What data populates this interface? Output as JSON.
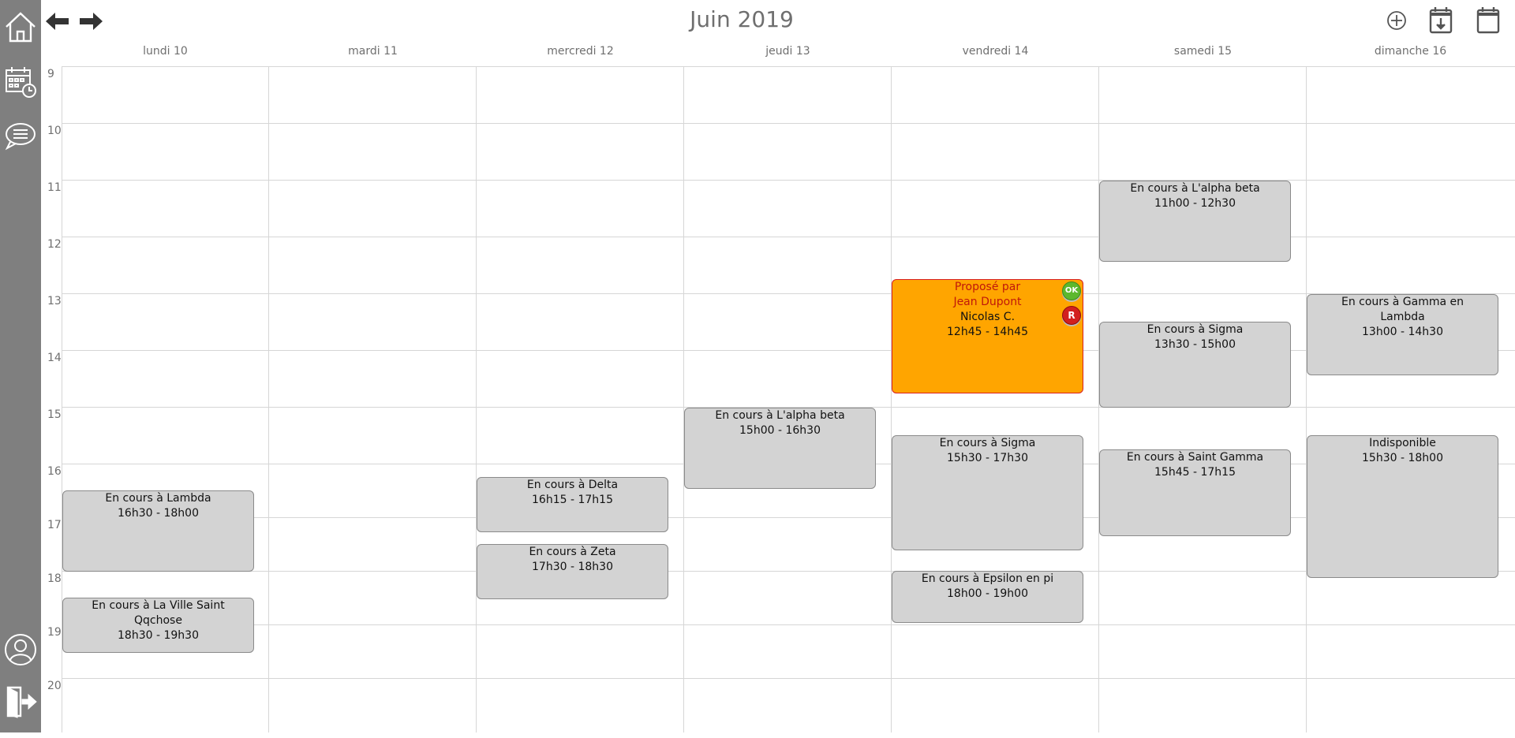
{
  "calendar": {
    "title": "Juin 2019"
  },
  "sidebar": {
    "items": [
      {
        "name": "home-icon"
      },
      {
        "name": "calendar-clock-icon"
      },
      {
        "name": "chat-icon"
      },
      {
        "name": "user-icon"
      },
      {
        "name": "logout-icon"
      }
    ]
  },
  "toolbar": {
    "icons": [
      "arrow-left-icon",
      "arrow-right-icon",
      "add-icon",
      "calendar-download-icon",
      "calendar-icon"
    ]
  },
  "days": [
    "lundi 10",
    "mardi 11",
    "mercredi 12",
    "jeudi 13",
    "vendredi 14",
    "samedi 15",
    "dimanche 16"
  ],
  "hours": [
    "9",
    "10",
    "11",
    "12",
    "13",
    "14",
    "15",
    "16",
    "17",
    "18",
    "19",
    "20"
  ],
  "events": [
    {
      "day": 0,
      "lines": [
        "En cours à Lambda",
        "16h30 - 18h00"
      ]
    },
    {
      "day": 0,
      "lines": [
        "En cours à La Ville Saint",
        "Qqchose",
        "18h30 - 19h30"
      ]
    },
    {
      "day": 2,
      "lines": [
        "En cours à Delta",
        "16h15 - 17h15"
      ]
    },
    {
      "day": 2,
      "lines": [
        "En cours à Zeta",
        "17h30 - 18h30"
      ]
    },
    {
      "day": 3,
      "lines": [
        "En cours à L'alpha beta",
        "15h00 - 16h30"
      ]
    },
    {
      "day": 4,
      "type": "proposed",
      "lines": [
        "Proposé par",
        "Jean Dupont",
        "Nicolas C.",
        "12h45 - 14h45"
      ],
      "badges": [
        "OK",
        "R"
      ]
    },
    {
      "day": 4,
      "lines": [
        "En cours à Sigma",
        "15h30 - 17h30"
      ]
    },
    {
      "day": 4,
      "lines": [
        "En cours à Epsilon en pi",
        "18h00 - 19h00"
      ]
    },
    {
      "day": 5,
      "lines": [
        "En cours à L'alpha beta",
        "11h00 - 12h30"
      ]
    },
    {
      "day": 5,
      "lines": [
        "En cours à Sigma",
        "13h30 - 15h00"
      ]
    },
    {
      "day": 5,
      "lines": [
        "En cours à Saint Gamma",
        "15h45 - 17h15"
      ]
    },
    {
      "day": 6,
      "lines": [
        "En cours à Gamma en",
        "Lambda",
        "13h00 - 14h30"
      ]
    },
    {
      "day": 6,
      "lines": [
        "Indisponible",
        "15h30 - 18h00"
      ]
    }
  ],
  "colors": {
    "sidebar": "#7f7f7f",
    "event": "#d3d3d3",
    "proposed": "#ffa500",
    "proposed_text": "#c0180a"
  }
}
